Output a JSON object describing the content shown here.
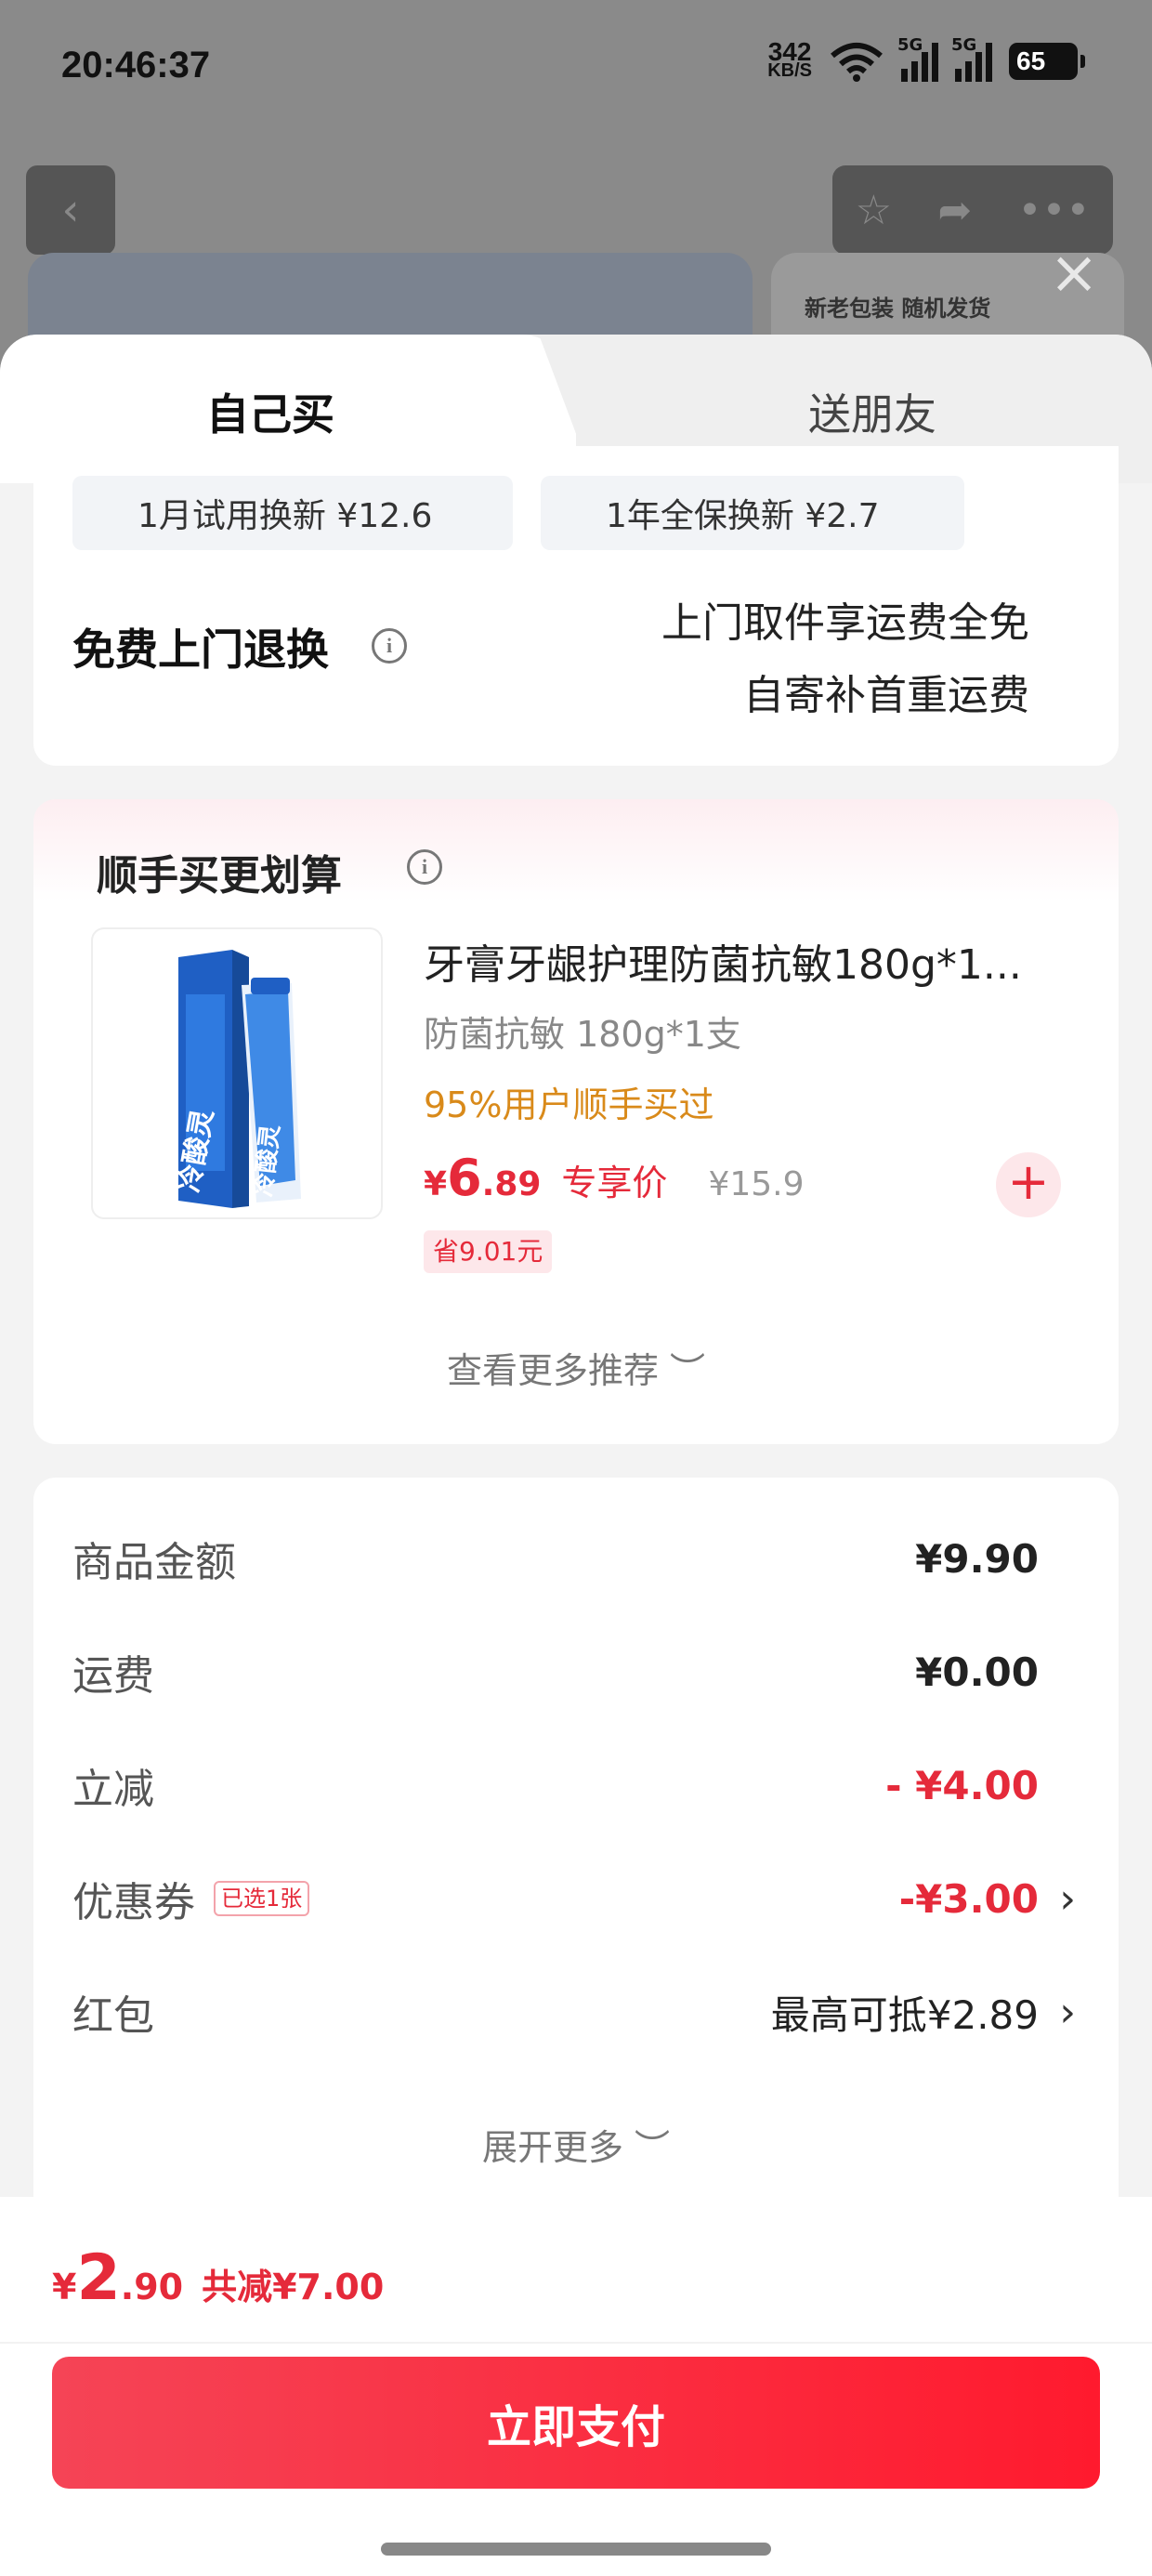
{
  "status_bar": {
    "time": "20:46:37",
    "net_speed_value": "342",
    "net_speed_unit": "KB/S",
    "signal1_label": "5G",
    "signal2_label": "5G",
    "battery": "65"
  },
  "background_page": {
    "banner_text": "新老包装 随机发货",
    "icons": [
      "back-icon",
      "star-icon",
      "share-icon",
      "more-icon",
      "close-icon"
    ]
  },
  "tabs": [
    {
      "label": "自己买",
      "active": true
    },
    {
      "label": "送朋友",
      "active": false
    }
  ],
  "service": {
    "chip1": "1月试用换新  ¥12.6",
    "chip2": "1年全保换新  ¥2.7",
    "title": "免费上门退换",
    "desc_line1": "上门取件享运费全免",
    "desc_line2": "自寄补首重运费"
  },
  "recommend": {
    "title": "顺手买更划算",
    "product_name": "牙膏牙龈护理防菌抗敏180g*1...",
    "spec": "防菌抗敏 180g*1支",
    "social_proof": "95%用户顺手买过",
    "price_symbol": "¥",
    "price_int": "6",
    "price_dec": ".89",
    "price_tag": "专享价",
    "original_price": "¥15.9",
    "save": "省9.01元",
    "more": "查看更多推荐",
    "product_brand_text": "冷酸灵"
  },
  "summary": {
    "rows": [
      {
        "label": "商品金额",
        "value": "¥9.90"
      },
      {
        "label": "运费",
        "value": "¥0.00"
      },
      {
        "label": "立减",
        "value": "- ¥4.00"
      },
      {
        "label": "优惠券",
        "badge": "已选1张",
        "value": "-¥3.00"
      },
      {
        "label": "红包",
        "value": "最高可抵¥2.89"
      }
    ],
    "more": "展开更多"
  },
  "bottom": {
    "total_symbol": "¥",
    "total_int": "2",
    "total_dec": ".90",
    "reduce": "共减¥7.00",
    "pay_button": "立即支付"
  },
  "colors": {
    "accent_red": "#e52a3a",
    "orange": "#d98a1a",
    "pay_gradient_start": "#f54456",
    "pay_gradient_end": "#ff1a2e"
  }
}
